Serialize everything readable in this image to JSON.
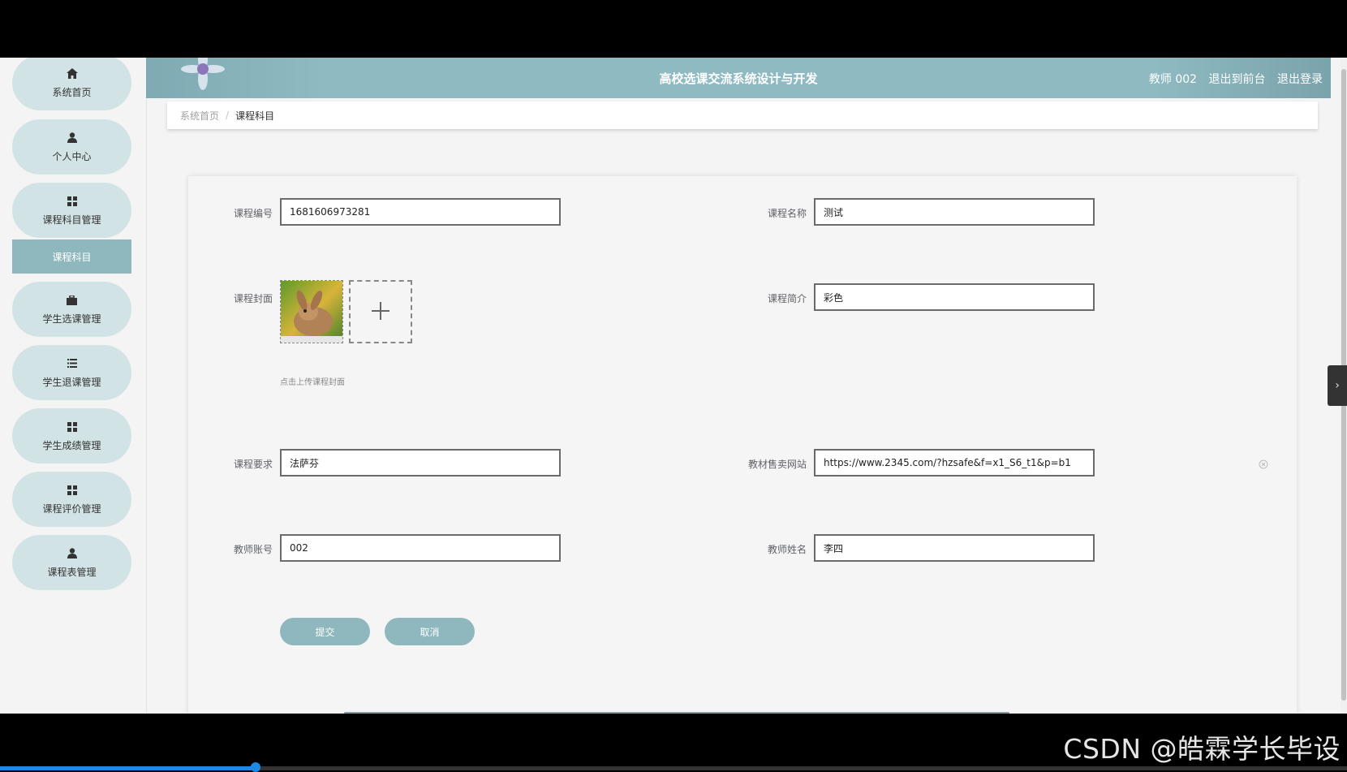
{
  "sidebar": {
    "items": [
      {
        "label": "系统首页",
        "icon": "home-icon"
      },
      {
        "label": "个人中心",
        "icon": "user-icon"
      },
      {
        "label": "课程科目管理",
        "icon": "grid-icon"
      },
      {
        "label": "学生选课管理",
        "icon": "briefcase-icon"
      },
      {
        "label": "学生退课管理",
        "icon": "list-icon"
      },
      {
        "label": "学生成绩管理",
        "icon": "grid-icon"
      },
      {
        "label": "课程评价管理",
        "icon": "grid-icon"
      },
      {
        "label": "课程表管理",
        "icon": "user-icon"
      }
    ],
    "sub_item": "课程科目"
  },
  "header": {
    "title": "高校选课交流系统设计与开发",
    "user": "教师 002",
    "back_to_front": "退出到前台",
    "logout": "退出登录"
  },
  "breadcrumb": {
    "home": "系统首页",
    "separator": "/",
    "current": "课程科目"
  },
  "form": {
    "course_no_label": "课程编号",
    "course_no": "1681606973281",
    "course_name_label": "课程名称",
    "course_name": "测试",
    "cover_label": "课程封面",
    "cover_hint": "点击上传课程封面",
    "intro_label": "课程简介",
    "intro": "彩色",
    "requirement_label": "课程要求",
    "requirement": "法萨芬",
    "book_site_label": "教材售卖网站",
    "book_site": "https://www.2345.com/?hzsafe&f=x1_S6_t1&p=b1",
    "teacher_account_label": "教师账号",
    "teacher_account": "002",
    "teacher_name_label": "教师姓名",
    "teacher_name": "李四",
    "submit": "提交",
    "cancel": "取消"
  },
  "watermark": "CSDN @皓霖学长毕设",
  "video_progress": 0.19,
  "colors": {
    "accent": "#8fb7be",
    "sidebar_item_bg": "#d2e3e6"
  }
}
